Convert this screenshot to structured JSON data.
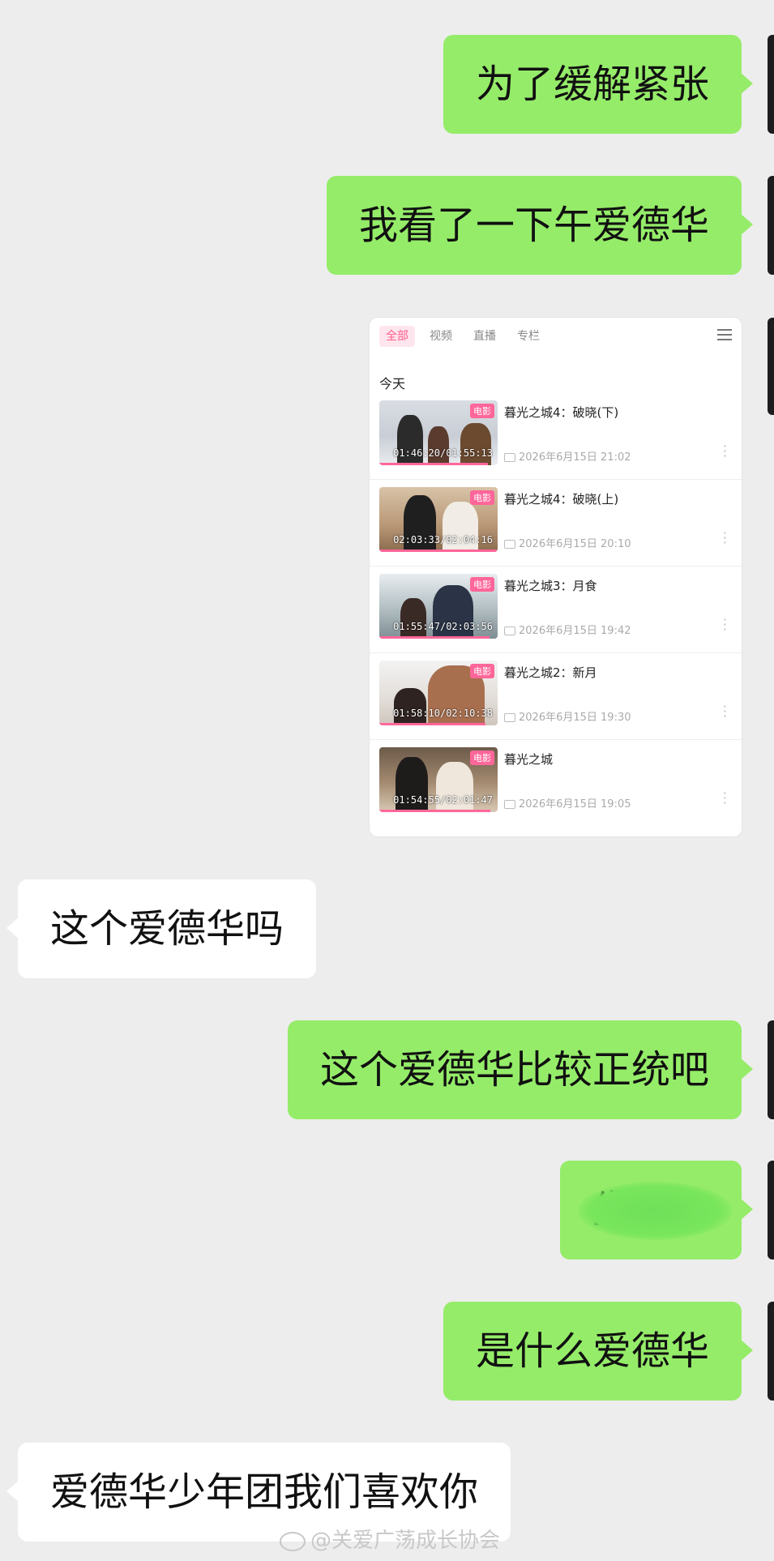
{
  "messages": [
    {
      "text": "为了缓解紧张"
    },
    {
      "text": "我看了一下午爱德华"
    },
    {
      "text": "这个爱德华吗"
    },
    {
      "text": "这个爱德华比较正统吧"
    },
    {
      "text": "生"
    },
    {
      "text": "是什么爱德华"
    },
    {
      "text": "爱德华少年团我们喜欢你"
    }
  ],
  "history_card": {
    "tabs": [
      "全部",
      "视频",
      "直播",
      "专栏"
    ],
    "section": "今天",
    "badge": "电影",
    "items": [
      {
        "title": "暮光之城4：破晓(下)",
        "duration": "01:46:20/01:55:13",
        "time": "2026年6月15日 21:02",
        "progress": 0.92
      },
      {
        "title": "暮光之城4：破晓(上)",
        "duration": "02:03:33/02:04:16",
        "time": "2026年6月15日 20:10",
        "progress": 0.99
      },
      {
        "title": "暮光之城3：月食",
        "duration": "01:55:47/02:03:56",
        "time": "2026年6月15日 19:42",
        "progress": 0.93
      },
      {
        "title": "暮光之城2：新月",
        "duration": "01:58:10/02:10:38",
        "time": "2026年6月15日 19:30",
        "progress": 0.9
      },
      {
        "title": "暮光之城",
        "duration": "01:54:55/02:01:47",
        "time": "2026年6月15日 19:05",
        "progress": 0.94
      }
    ]
  },
  "watermark": "@关爱广荡成长协会"
}
